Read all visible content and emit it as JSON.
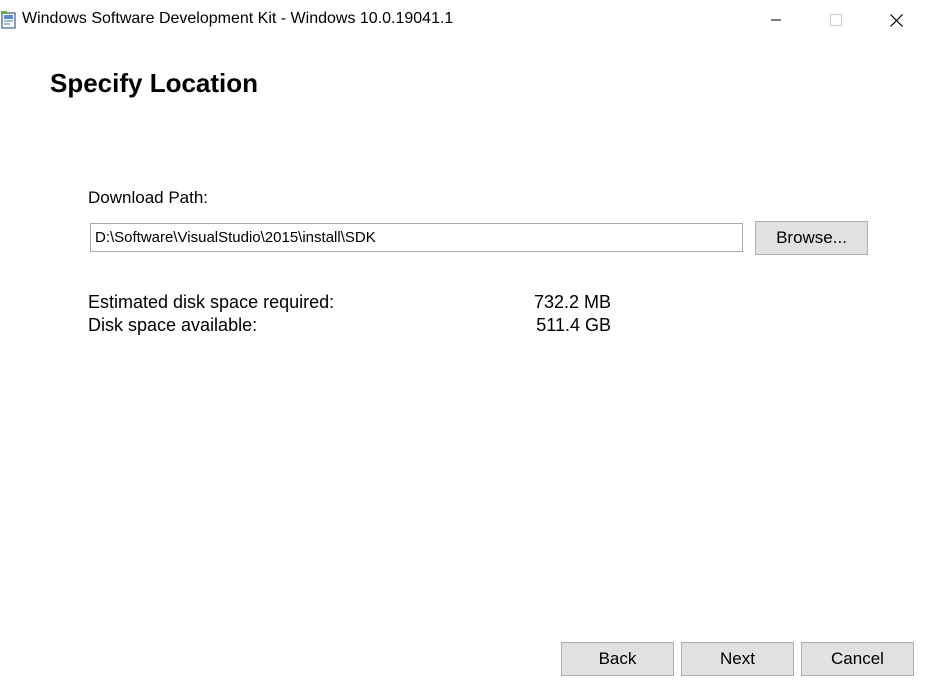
{
  "window": {
    "title": "Windows Software Development Kit - Windows 10.0.19041.1"
  },
  "page": {
    "heading": "Specify Location"
  },
  "download": {
    "label": "Download Path:",
    "path_value": "D:\\Software\\VisualStudio\\2015\\install\\SDK",
    "browse_label": "Browse..."
  },
  "disk": {
    "required_label": "Estimated disk space required:",
    "required_value": "732.2 MB",
    "available_label": "Disk space available:",
    "available_value": "511.4 GB"
  },
  "footer": {
    "back_label": "Back",
    "next_label": "Next",
    "cancel_label": "Cancel"
  },
  "icons": {
    "app": "installer-icon",
    "minimize": "minimize-icon",
    "maximize": "maximize-icon",
    "close": "close-icon"
  },
  "colors": {
    "background": "#ffffff",
    "button_face": "#e1e1e1",
    "button_border": "#adadad"
  }
}
